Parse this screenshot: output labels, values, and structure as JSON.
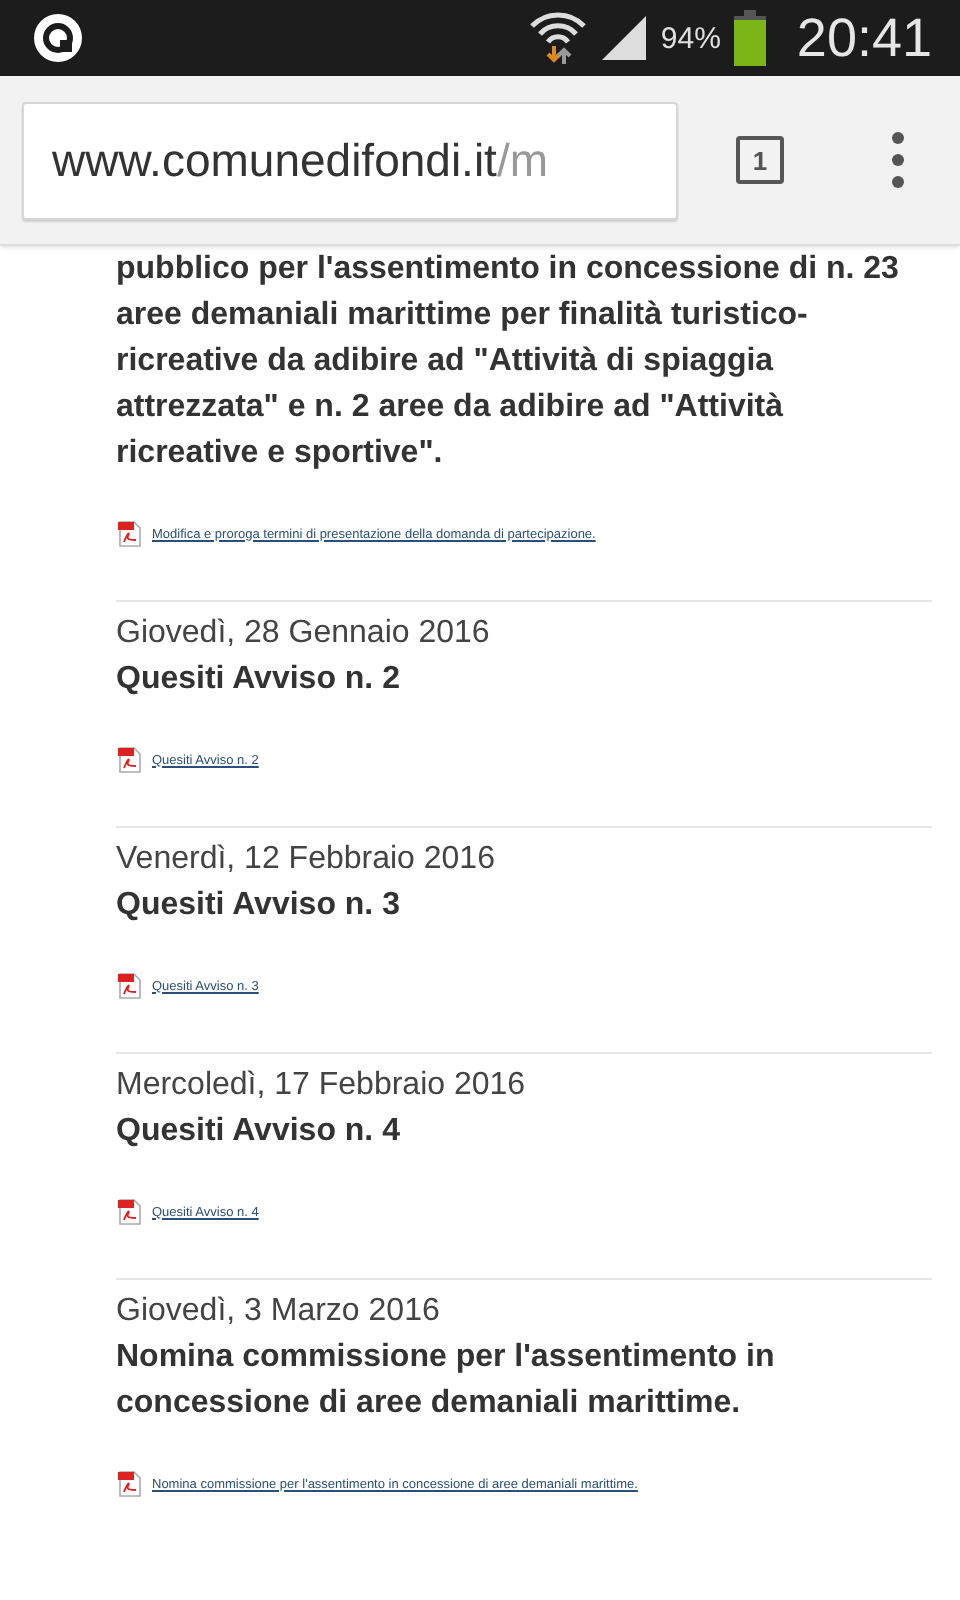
{
  "status_bar": {
    "battery_text": "94%",
    "time": "20:41"
  },
  "browser": {
    "url_host": "www.comunedifondi.it",
    "url_path": "/m",
    "tab_count": "1"
  },
  "posts": [
    {
      "title": "pubblico per l'assentimento in concessione di n. 23 aree demaniali marittime per finalità turistico-ricreative da adibire ad \"Attività di spiaggia attrezzata\" e n. 2 aree da adibire ad \"Attività ricreative e sportive\".",
      "attachment": "Modifica e proroga termini di presentazione della domanda di partecipazione."
    },
    {
      "date": "Giovedì, 28 Gennaio 2016",
      "title": "Quesiti Avviso n. 2",
      "attachment": "Quesiti Avviso n. 2"
    },
    {
      "date": "Venerdì, 12 Febbraio 2016",
      "title": "Quesiti Avviso n. 3",
      "attachment": "Quesiti Avviso n. 3"
    },
    {
      "date": "Mercoledì, 17 Febbraio 2016",
      "title": "Quesiti Avviso n. 4",
      "attachment": "Quesiti Avviso n. 4"
    },
    {
      "date": "Giovedì, 3 Marzo 2016",
      "title": "Nomina commissione per l'assentimento in concessione di aree demaniali marittime.",
      "attachment": "Nomina commissione per l'assentimento in concessione di aree demaniali marittime."
    }
  ]
}
